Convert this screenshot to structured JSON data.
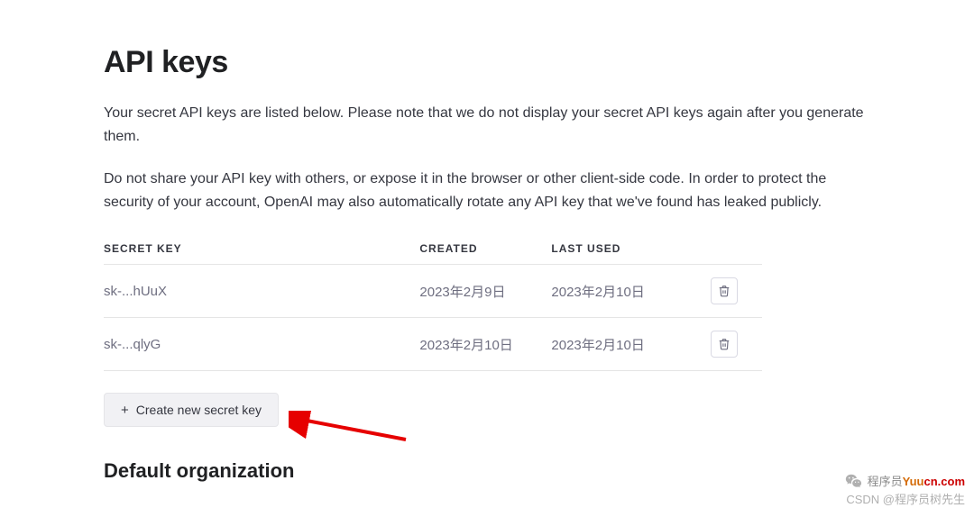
{
  "page": {
    "title": "API keys",
    "description1": "Your secret API keys are listed below. Please note that we do not display your secret API keys again after you generate them.",
    "description2": "Do not share your API key with others, or expose it in the browser or other client-side code. In order to protect the security of your account, OpenAI may also automatically rotate any API key that we've found has leaked publicly."
  },
  "table": {
    "headers": {
      "key": "SECRET KEY",
      "created": "CREATED",
      "used": "LAST USED"
    },
    "rows": [
      {
        "key": "sk-...hUuX",
        "created": "2023年2月9日",
        "used": "2023年2月10日"
      },
      {
        "key": "sk-...qlyG",
        "created": "2023年2月10日",
        "used": "2023年2月10日"
      }
    ]
  },
  "actions": {
    "create_label": "Create new secret key"
  },
  "section": {
    "default_org": "Default organization"
  },
  "watermark": {
    "line1_prefix": "程序员",
    "line1_accent": "Yuu",
    "line1_suffix": "cn.com",
    "line2": "CSDN @程序员树先生"
  }
}
